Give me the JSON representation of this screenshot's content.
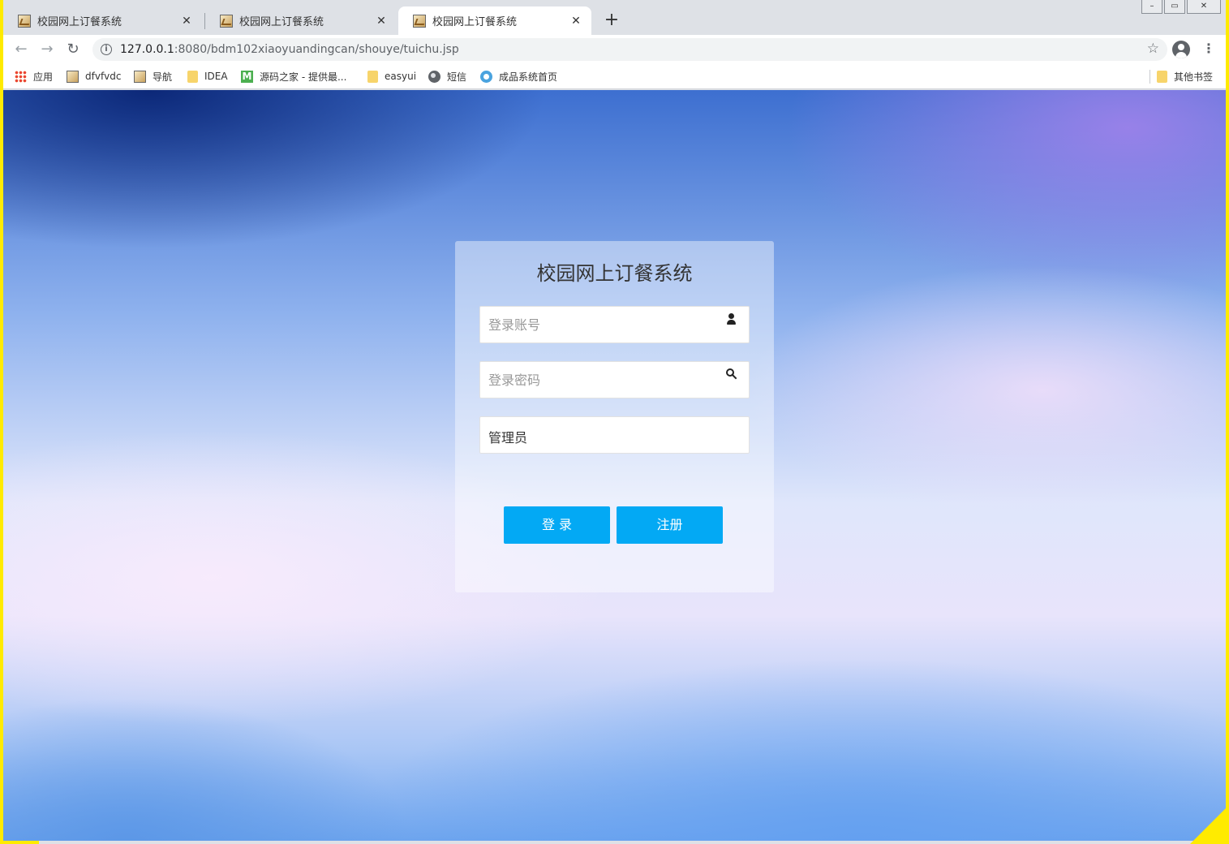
{
  "browser": {
    "tabs": [
      {
        "title": "校园网上订餐系统",
        "active": false
      },
      {
        "title": "校园网上订餐系统",
        "active": false
      },
      {
        "title": "校园网上订餐系统",
        "active": true
      }
    ],
    "new_tab_label": "+",
    "window_controls": {
      "minimize": "–",
      "restore": "▭",
      "close": "✕"
    },
    "url_host": "127.0.0.1",
    "url_path": ":8080/bdm102xiaoyuandingcan/shouye/tuichu.jsp",
    "bookmarks": [
      {
        "label": "应用",
        "icon": "apps-grid-icon"
      },
      {
        "label": "dfvfvdc",
        "icon": "page-image-icon"
      },
      {
        "label": "导航",
        "icon": "page-image-icon"
      },
      {
        "label": "IDEA",
        "icon": "folder-icon"
      },
      {
        "label": "源码之家 - 提供最...",
        "icon": "m-logo-icon"
      },
      {
        "label": "easyui",
        "icon": "folder-icon"
      },
      {
        "label": "短信",
        "icon": "globe-icon"
      },
      {
        "label": "成品系统首页",
        "icon": "gear-icon"
      }
    ],
    "other_bookmarks": "其他书签"
  },
  "login": {
    "title": "校园网上订餐系统",
    "username_placeholder": "登录账号",
    "password_placeholder": "登录密码",
    "role_value": "管理员",
    "login_button": "登 录",
    "register_button": "注册"
  },
  "colors": {
    "button": "#03a9f4",
    "card": "rgba(255,255,255,0.42)",
    "border_accent": "#ffeb00"
  }
}
